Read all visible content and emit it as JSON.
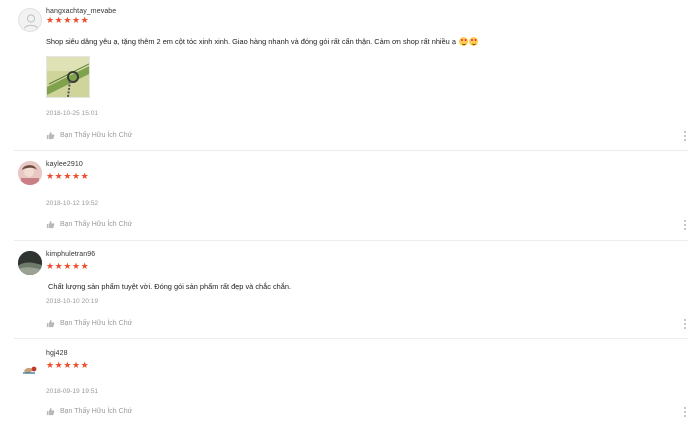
{
  "accent_color": "#ee4d2d",
  "reviews": [
    {
      "username": "hangxachtay_mevabe",
      "stars": "★★★★★",
      "rating": 5,
      "comment": "Shop siêu dâng yêu ạ, tặng thêm 2 em cột tóc xinh xinh. Giao hàng nhanh và đóng gói rất cẩn thận. Cảm ơn shop rất nhiều ạ",
      "has_photo": true,
      "timestamp": "2018-10-25 15:01",
      "helpful_label": "Bạn Thấy Hữu Ích Chứ"
    },
    {
      "username": "kaylee2910",
      "stars": "★★★★★",
      "rating": 5,
      "timestamp": "2018-10-12 19:52",
      "helpful_label": "Bạn Thấy Hữu Ích Chứ"
    },
    {
      "username": "kimphuletran96",
      "stars": "★★★★★",
      "rating": 5,
      "comment": "Chất lượng sản phẩm tuyệt vời.  Đóng gói sản phẩm rất đẹp và chắc chắn.",
      "timestamp": "2018-10-10 20:19",
      "helpful_label": "Bạn Thấy Hữu Ích Chứ"
    },
    {
      "username": "hgj428",
      "stars": "★★★★★",
      "rating": 5,
      "timestamp": "2018-09-19 19:51",
      "helpful_label": "Bạn Thấy Hữu Ích Chứ"
    }
  ]
}
